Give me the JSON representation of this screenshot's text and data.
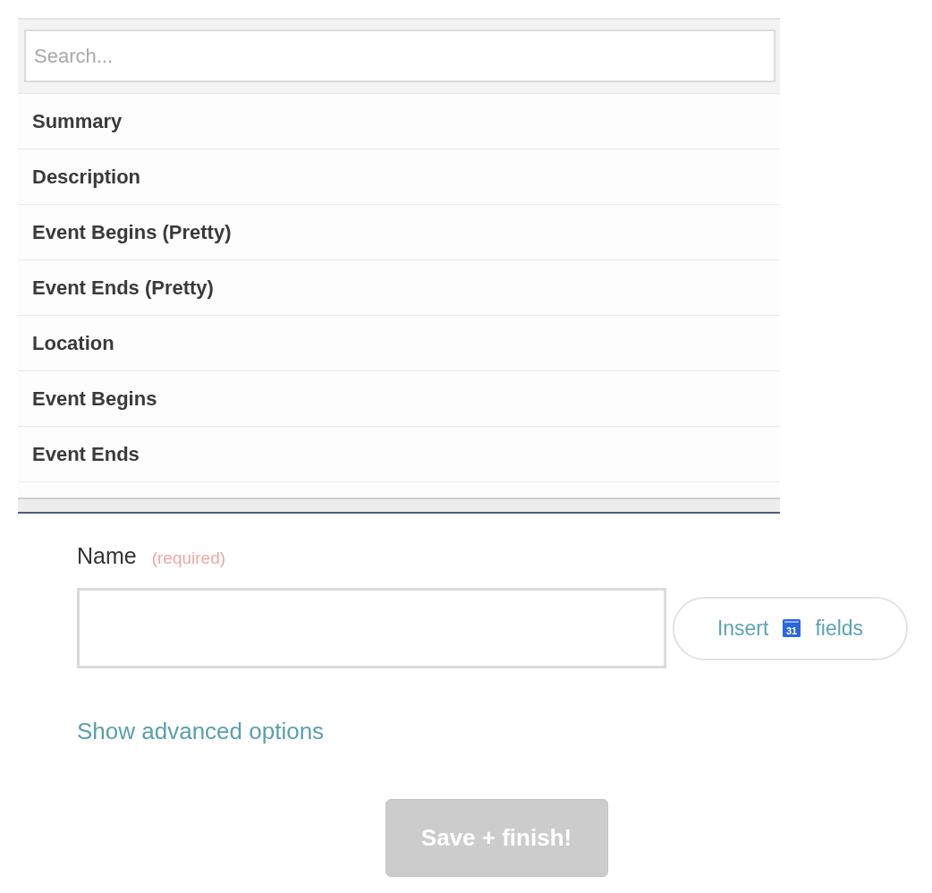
{
  "search": {
    "placeholder": "Search..."
  },
  "options": [
    {
      "label": "Summary",
      "selected": false
    },
    {
      "label": "Description",
      "selected": false
    },
    {
      "label": "Event Begins (Pretty)",
      "selected": false
    },
    {
      "label": "Event Ends (Pretty)",
      "selected": false
    },
    {
      "label": "Location",
      "selected": false
    },
    {
      "label": "Event Begins",
      "selected": false
    },
    {
      "label": "Event Ends",
      "selected": false
    }
  ],
  "name_field": {
    "label": "Name",
    "required_note": "(required)"
  },
  "insert_button": {
    "label_before": "Insert",
    "icon_text": "31",
    "label_after": "fields"
  },
  "advanced_link": "Show advanced options",
  "save_button": {
    "label": "Save + finish!",
    "disabled": true
  }
}
